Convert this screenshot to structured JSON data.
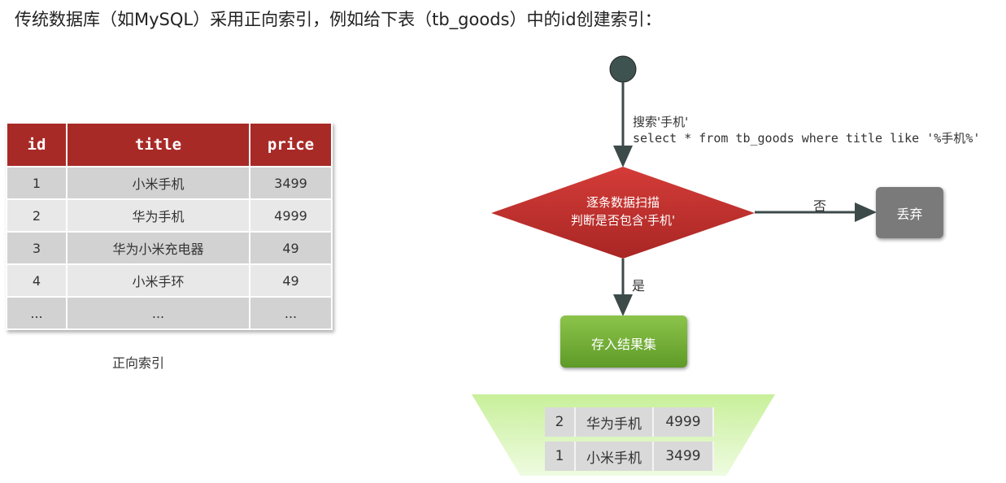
{
  "heading": "传统数据库（如MySQL）采用正向索引，例如给下表（tb_goods）中的id创建索引：",
  "table": {
    "columns": [
      "id",
      "title",
      "price"
    ],
    "rows": [
      [
        "1",
        "小米手机",
        "3499"
      ],
      [
        "2",
        "华为手机",
        "4999"
      ],
      [
        "3",
        "华为小米充电器",
        "49"
      ],
      [
        "4",
        "小米手环",
        "49"
      ],
      [
        "...",
        "...",
        "..."
      ]
    ]
  },
  "caption": "正向索引",
  "flow": {
    "search_label": "搜索'手机'",
    "sql": "select * from tb_goods where title like '%手机%'",
    "decision_line1": "逐条数据扫描",
    "decision_line2": "判断是否包含'手机'",
    "no_label": "否",
    "yes_label": "是",
    "discard": "丢弃",
    "store": "存入结果集"
  },
  "results": [
    [
      "2",
      "华为手机",
      "4999"
    ],
    [
      "1",
      "小米手机",
      "3499"
    ]
  ],
  "colors": {
    "header_red": "#a82a27",
    "diamond_red": "#c33431",
    "green": "#7cb33a",
    "gray_box": "#7a7a7a",
    "funnel": "#d6f5b0"
  }
}
